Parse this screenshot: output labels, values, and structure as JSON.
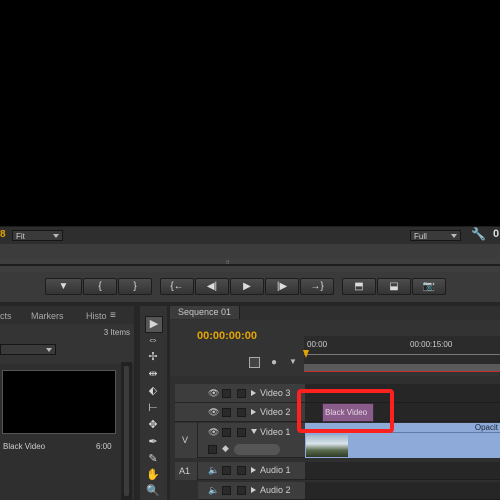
{
  "monitor": {
    "timecode_fragment": "8",
    "zoom_select": "Fit",
    "quality_select": "Full",
    "right_timecode_fragment": "0",
    "scrub_marker": "⁞⁞"
  },
  "transport": {
    "buttons": [
      {
        "name": "add-marker-button",
        "glyph": "▼"
      },
      {
        "name": "mark-in-button",
        "glyph": "{"
      },
      {
        "name": "mark-out-button",
        "glyph": "}"
      },
      {
        "name": "go-to-in-button",
        "glyph": "{←"
      },
      {
        "name": "step-back-button",
        "glyph": "◀|"
      },
      {
        "name": "play-button",
        "glyph": "▶"
      },
      {
        "name": "step-forward-button",
        "glyph": "|▶"
      },
      {
        "name": "go-to-out-button",
        "glyph": "→}"
      },
      {
        "name": "lift-button",
        "glyph": "⬒"
      },
      {
        "name": "extract-button",
        "glyph": "⬓"
      },
      {
        "name": "export-frame-button",
        "glyph": "📷"
      }
    ]
  },
  "project": {
    "tabs": [
      "cts",
      "Markers",
      "Histo"
    ],
    "items_count": "3 Items",
    "clip_name": "Black Video",
    "clip_duration": "6:00"
  },
  "tools": [
    "▶",
    "⇔",
    "✢",
    "⇹",
    "⬖",
    "⊢",
    "✥",
    "✒",
    "✋",
    "🔍"
  ],
  "timeline": {
    "tab_label": "Sequence 01",
    "tab_close": "×",
    "current_timecode": "00:00:00:00",
    "ruler_start": "00:00",
    "ruler_mid": "00:00:15:00",
    "tracks": {
      "video3": "Video 3",
      "video2": "Video 2",
      "video1": "Video 1",
      "audio1": "Audio 1",
      "audio2": "Audio 2"
    },
    "source_v_label": "V",
    "source_a1_label": "A1",
    "black_video_clip": "Black Video",
    "opacity_label": "Opacit"
  },
  "colors": {
    "timecode_accent": "#e5a500",
    "highlight": "#ff2020",
    "black_video_clip": "#8a5c8a",
    "video_clip": "#8eaad8"
  }
}
